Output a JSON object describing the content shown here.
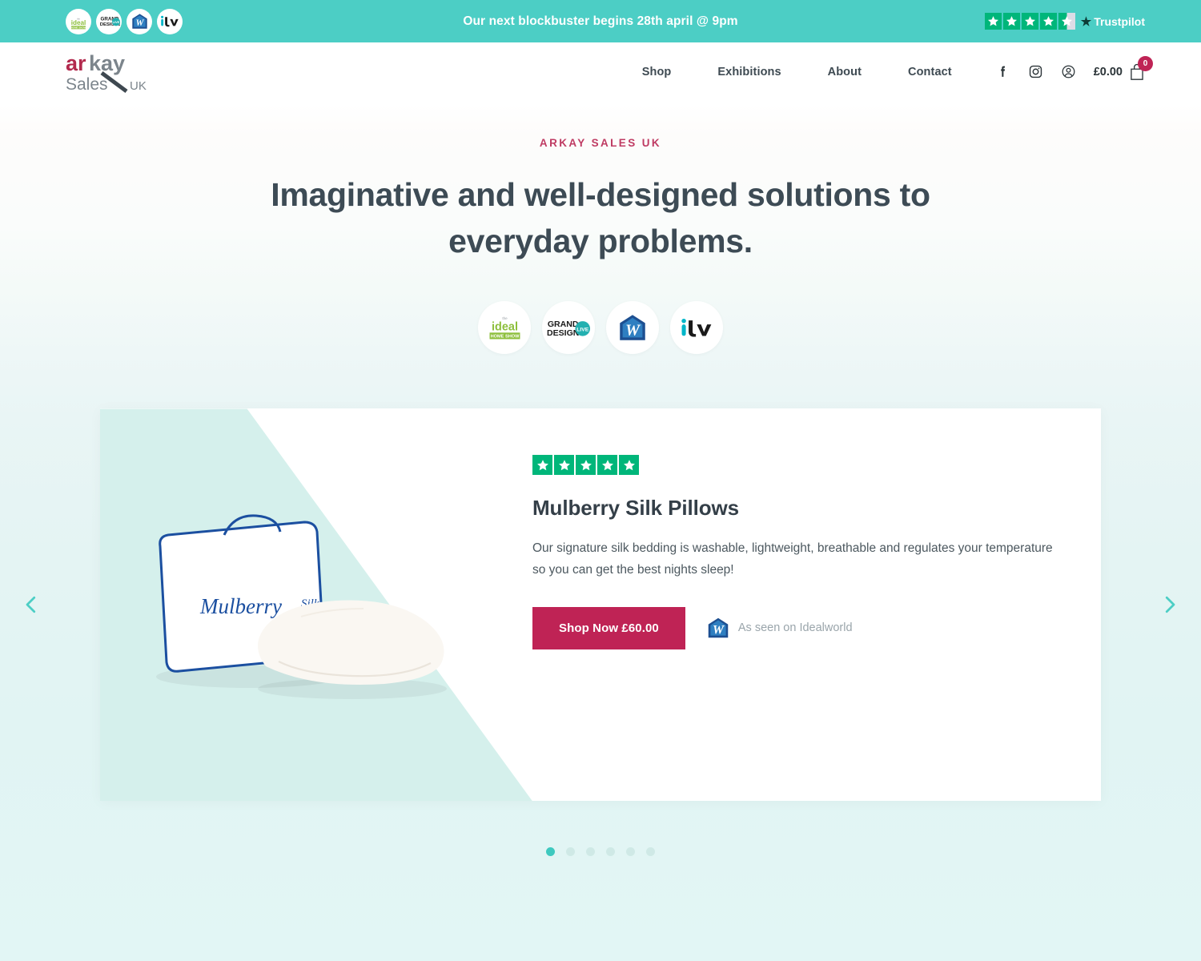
{
  "topbar": {
    "message": "Our next blockbuster begins 28th april @ 9pm",
    "bg_color": "#4ccec5",
    "badges": [
      {
        "name": "ideal-home-show",
        "label": "the ideal HOME SHOW"
      },
      {
        "name": "grand-designs-live",
        "label": "GRAND DESIGNS LIVE"
      },
      {
        "name": "idealworld",
        "label": "Idealworld"
      },
      {
        "name": "itv",
        "label": "itv"
      }
    ],
    "trustpilot": {
      "name": "Trustpilot",
      "rating": 4.5,
      "max": 5,
      "full_stars": 4,
      "half_stars": 1,
      "star_color": "#00b67a"
    }
  },
  "header": {
    "logo": {
      "text_primary": "ar",
      "text_secondary": "kay",
      "text_tertiary": "Sales",
      "text_suffix": "UK",
      "color_primary": "#b32a4e",
      "color_secondary": "#7c858c"
    },
    "nav": [
      {
        "label": "Shop"
      },
      {
        "label": "Exhibitions"
      },
      {
        "label": "About"
      },
      {
        "label": "Contact"
      }
    ],
    "icons": [
      {
        "name": "facebook-icon"
      },
      {
        "name": "instagram-icon"
      },
      {
        "name": "account-icon"
      }
    ],
    "cart": {
      "price": "£0.00",
      "count": "0",
      "badge_color": "#bf2355"
    }
  },
  "hero": {
    "eyebrow": "ARKAY SALES UK",
    "eyebrow_color": "#bf3b63",
    "title_line1": "Imaginative and well-designed solutions to",
    "title_line2": "everyday problems.",
    "brands": [
      {
        "name": "ideal-home-show",
        "label": "the ideal HOME SHOW"
      },
      {
        "name": "grand-designs-live",
        "label": "GRAND DESIGNS LIVE"
      },
      {
        "name": "idealworld",
        "label": "Idealworld"
      },
      {
        "name": "itv",
        "label": "itv"
      }
    ]
  },
  "carousel": {
    "prev_label": "Previous slide",
    "next_label": "Next slide",
    "total_slides": 6,
    "active_slide": 1,
    "accent_color": "#3ec9bf",
    "slide": {
      "rating": 5,
      "rating_max": 5,
      "title": "Mulberry Silk Pillows",
      "description": "Our signature silk bedding is washable, lightweight, breathable and regulates your temperature so you can get the best nights sleep!",
      "cta_label": "Shop Now £60.00",
      "cta_color": "#bf2355",
      "price": "£60.00",
      "seen_on_label": "As seen on Idealworld",
      "seen_on_brand": "Idealworld",
      "image_caption": "Mulberry Silk"
    }
  }
}
